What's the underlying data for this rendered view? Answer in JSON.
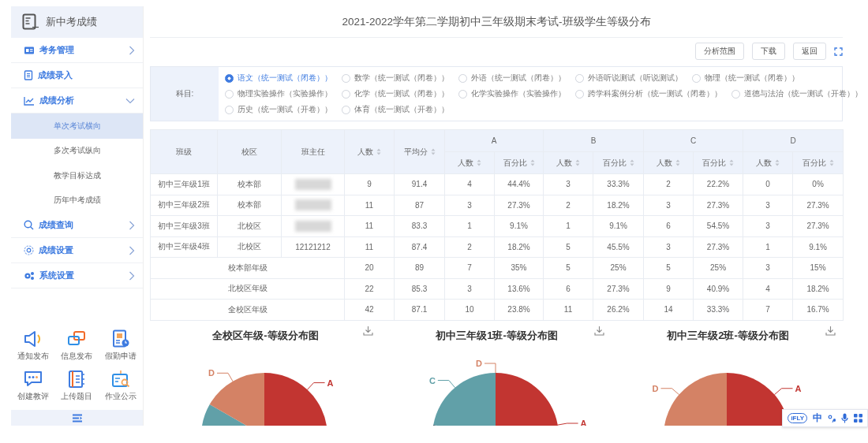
{
  "sidebar": {
    "logo_text": "新中考成绩",
    "menu": [
      {
        "label": "考务管理",
        "expanded": false
      },
      {
        "label": "成绩录入"
      },
      {
        "label": "成绩分析",
        "expanded": true,
        "children": [
          {
            "label": "单次考试横向",
            "selected": true
          },
          {
            "label": "多次考试纵向",
            "selected": false
          },
          {
            "label": "教学目标达成",
            "selected": false
          },
          {
            "label": "历年中考成绩",
            "selected": false
          }
        ]
      },
      {
        "label": "成绩查询",
        "expanded": false
      },
      {
        "label": "成绩设置",
        "expanded": false
      },
      {
        "label": "系统设置",
        "expanded": false
      }
    ],
    "quick_apps": [
      {
        "label": "通知发布"
      },
      {
        "label": "信息发布"
      },
      {
        "label": "假勤申请"
      },
      {
        "label": "创建教评"
      },
      {
        "label": "上传题目"
      },
      {
        "label": "作业公示"
      }
    ]
  },
  "page_title": "2021-2022学年第二学期初中三年级期末考试-班级学生等级分布",
  "toolbar": {
    "buttons": [
      "分析范围",
      "下载",
      "返回"
    ]
  },
  "filter": {
    "label": "科目:",
    "option_rows": [
      {
        "options": [
          {
            "label": "语文（统一测试（闭卷））",
            "selected": true
          },
          {
            "label": "数学（统一测试（闭卷））",
            "selected": false
          },
          {
            "label": "外语（统一测试（闭卷））",
            "selected": false
          },
          {
            "label": "外语听说测试（听说测试）",
            "selected": false
          },
          {
            "label": "物理（统一测试（闭卷））",
            "selected": false
          }
        ]
      },
      {
        "options": [
          {
            "label": "物理实验操作（实验操作）",
            "selected": false
          },
          {
            "label": "化学（统一测试（闭卷））",
            "selected": false
          },
          {
            "label": "化学实验操作（实验操作）",
            "selected": false
          },
          {
            "label": "跨学科案例分析（统一测试（闭卷））",
            "selected": false
          },
          {
            "label": "道德与法治（统一测试（开卷））",
            "selected": false
          }
        ]
      },
      {
        "options": [
          {
            "label": "历史（统一测试（开卷））",
            "selected": false
          },
          {
            "label": "体育（统一测试（开卷））",
            "selected": false
          }
        ]
      }
    ]
  },
  "table": {
    "columns": [
      {
        "label": "班级",
        "sortable": false
      },
      {
        "label": "校区",
        "sortable": false
      },
      {
        "label": "班主任",
        "sortable": false
      },
      {
        "label": "人数",
        "sortable": true
      },
      {
        "label": "平均分",
        "sortable": true
      }
    ],
    "groups": [
      {
        "label": "A",
        "subcolumns": [
          {
            "label": "人数",
            "sortable": true
          },
          {
            "label": "百分比",
            "sortable": true
          }
        ]
      },
      {
        "label": "B",
        "subcolumns": [
          {
            "label": "人数",
            "sortable": true
          },
          {
            "label": "百分比",
            "sortable": true
          }
        ]
      },
      {
        "label": "C",
        "subcolumns": [
          {
            "label": "人数",
            "sortable": true
          },
          {
            "label": "百分比",
            "sortable": true
          }
        ]
      },
      {
        "label": "D",
        "subcolumns": [
          {
            "label": "人数",
            "sortable": true
          },
          {
            "label": "百分比",
            "sortable": true
          }
        ]
      }
    ],
    "rows": [
      {
        "kind": "class",
        "class_name": "初中三年级1班",
        "campus": "校本部",
        "teacher_blurred": true,
        "values": [
          "9",
          "91.4",
          "4",
          "44.4%",
          "3",
          "33.3%",
          "2",
          "22.2%",
          "0",
          "0%"
        ]
      },
      {
        "kind": "class",
        "class_name": "初中三年级2班",
        "campus": "校本部",
        "teacher_blurred": true,
        "values": [
          "11",
          "87",
          "3",
          "27.3%",
          "2",
          "18.2%",
          "3",
          "27.3%",
          "3",
          "27.3%"
        ]
      },
      {
        "kind": "class",
        "class_name": "初中三年级3班",
        "campus": "北校区",
        "teacher_blurred": true,
        "values": [
          "11",
          "83.3",
          "1",
          "9.1%",
          "1",
          "9.1%",
          "6",
          "54.5%",
          "3",
          "27.3%"
        ]
      },
      {
        "kind": "class",
        "class_name": "初中三年级4班",
        "campus": "北校区",
        "teacher": "12121212",
        "teacher_blurred": false,
        "values": [
          "11",
          "87.4",
          "2",
          "18.2%",
          "5",
          "45.5%",
          "3",
          "27.3%",
          "1",
          "9.1%"
        ]
      },
      {
        "kind": "summary",
        "label": "校本部年级",
        "values": [
          "20",
          "89",
          "7",
          "35%",
          "5",
          "25%",
          "5",
          "25%",
          "3",
          "15%"
        ]
      },
      {
        "kind": "summary",
        "label": "北校区年级",
        "values": [
          "22",
          "85.3",
          "3",
          "13.6%",
          "6",
          "27.3%",
          "9",
          "40.9%",
          "4",
          "18.2%"
        ]
      },
      {
        "kind": "summary",
        "label": "全校区年级",
        "values": [
          "42",
          "87.1",
          "10",
          "23.8%",
          "11",
          "26.2%",
          "14",
          "33.3%",
          "7",
          "16.7%"
        ]
      }
    ]
  },
  "charts": [
    {
      "title": "全校区年级-等级分布图",
      "slice_labels": [
        {
          "label": "D",
          "color": "#d48265"
        },
        {
          "label": "A",
          "color": "#c23531"
        }
      ]
    },
    {
      "title": "初中三年级1班-等级分布图",
      "slice_labels": [
        {
          "label": "D",
          "color": "#d48265"
        },
        {
          "label": "C",
          "color": "#61a0a8"
        },
        {
          "label": "A",
          "color": "#c23531"
        }
      ]
    },
    {
      "title": "初中三年级2班-等级分布图",
      "slice_labels": [
        {
          "label": "D",
          "color": "#d48265"
        },
        {
          "label": "A",
          "color": "#c23531"
        }
      ]
    }
  ],
  "ime_toolbar": {
    "logo": "iFLY",
    "label": "中"
  }
}
